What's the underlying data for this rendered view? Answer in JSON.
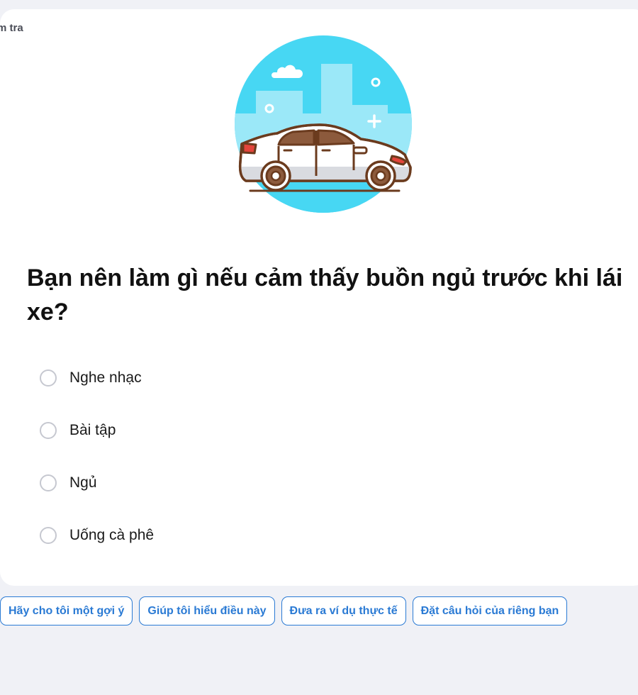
{
  "quiz": {
    "section_label": "m tra",
    "illustration_icon": "car-illustration-icon",
    "question": "Bạn nên làm gì nếu cảm thấy buồn ngủ trước khi lái xe?",
    "options": [
      {
        "label": "Nghe nhạc",
        "selected": false
      },
      {
        "label": "Bài tập",
        "selected": false
      },
      {
        "label": "Ngủ",
        "selected": false
      },
      {
        "label": "Uống cà phê",
        "selected": false
      }
    ]
  },
  "suggestions": [
    "Hãy cho tôi một gợi ý",
    "Giúp tôi hiểu điều này",
    "Đưa ra ví dụ thực tế",
    "Đặt câu hỏi của riêng bạn"
  ],
  "colors": {
    "background": "#f0f1f6",
    "accent": "#2a7ad4",
    "illustration_sky": "#47d7f3"
  }
}
